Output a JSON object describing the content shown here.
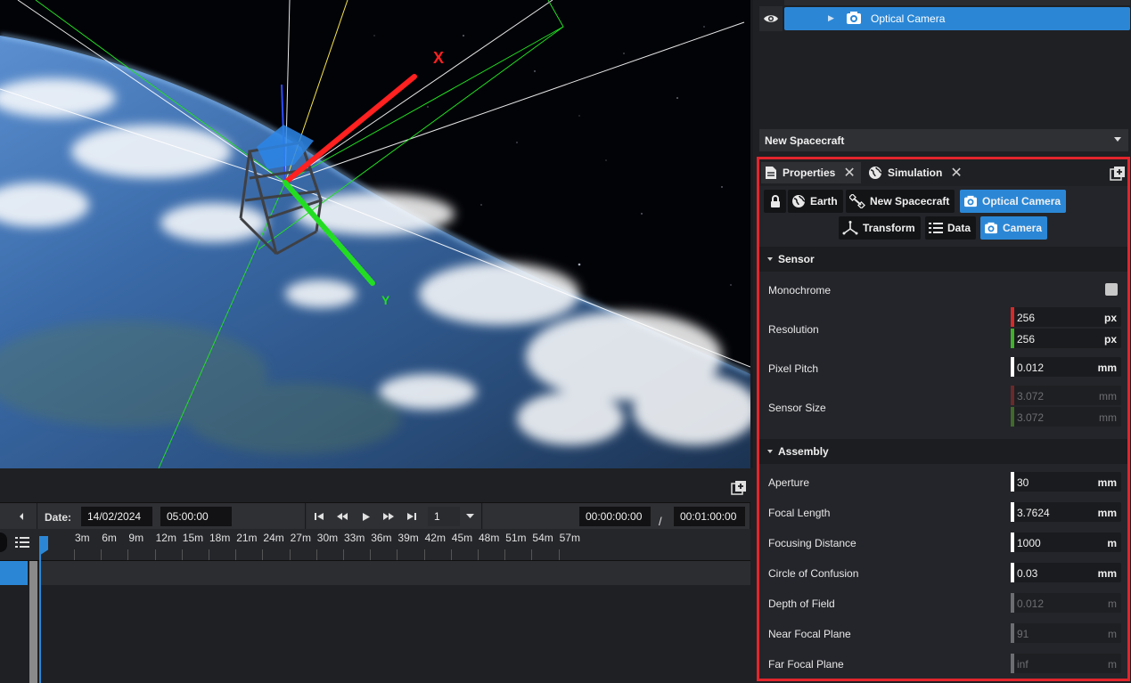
{
  "viewport": {
    "axis_x_label": "X",
    "axis_y_label": "Y"
  },
  "timeline": {
    "date_label": "Date:",
    "date_value": "14/02/2024",
    "time_value": "05:00:00",
    "speed_value": "1",
    "current_time": "00:00:00:00",
    "separator": "/",
    "end_time": "00:01:00:00",
    "ticks": [
      "3m",
      "6m",
      "9m",
      "12m",
      "15m",
      "18m",
      "21m",
      "24m",
      "27m",
      "30m",
      "33m",
      "36m",
      "39m",
      "42m",
      "45m",
      "48m",
      "51m",
      "54m",
      "57m"
    ]
  },
  "tree": {
    "selected_item": "Optical Camera"
  },
  "entity_selector": {
    "value": "New Spacecraft"
  },
  "panel": {
    "tabs": [
      {
        "label": "Properties"
      },
      {
        "label": "Simulation"
      }
    ],
    "breadcrumbs": [
      {
        "label": "Earth"
      },
      {
        "label": "New Spacecraft"
      },
      {
        "label": "Optical Camera"
      }
    ],
    "components": [
      {
        "label": "Transform"
      },
      {
        "label": "Data"
      },
      {
        "label": "Camera"
      }
    ],
    "sensor": {
      "title": "Sensor",
      "monochrome_label": "Monochrome",
      "resolution_label": "Resolution",
      "resolution_x": "256",
      "resolution_y": "256",
      "resolution_unit": "px",
      "pixel_pitch_label": "Pixel Pitch",
      "pixel_pitch": "0.012",
      "pixel_pitch_unit": "mm",
      "sensor_size_label": "Sensor Size",
      "sensor_size_x": "3.072",
      "sensor_size_y": "3.072",
      "sensor_size_unit": "mm"
    },
    "assembly": {
      "title": "Assembly",
      "rows": [
        {
          "label": "Aperture",
          "value": "30",
          "unit": "mm",
          "disabled": false
        },
        {
          "label": "Focal Length",
          "value": "3.7624",
          "unit": "mm",
          "disabled": false
        },
        {
          "label": "Focusing Distance",
          "value": "1000",
          "unit": "m",
          "disabled": false
        },
        {
          "label": "Circle of Confusion",
          "value": "0.03",
          "unit": "mm",
          "disabled": false
        },
        {
          "label": "Depth of Field",
          "value": "0.012",
          "unit": "m",
          "disabled": true
        },
        {
          "label": "Near Focal Plane",
          "value": "91",
          "unit": "m",
          "disabled": true
        },
        {
          "label": "Far Focal Plane",
          "value": "inf",
          "unit": "m",
          "disabled": true
        }
      ]
    }
  },
  "colors": {
    "accent": "#2b87d6",
    "highlight_border": "#e3252c",
    "axis_x": "#ff2020",
    "axis_y": "#22dd22"
  }
}
